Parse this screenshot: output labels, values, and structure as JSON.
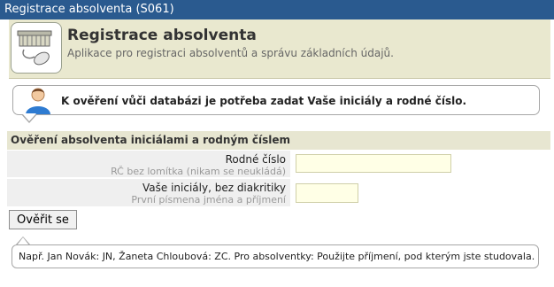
{
  "window": {
    "title": "Registrace absolventa (S061)"
  },
  "app": {
    "icon": "registration-desk-mouse-icon",
    "title": "Registrace absolventa",
    "subtitle": "Aplikace pro registraci absolventů a správu základních údajů."
  },
  "info_message": {
    "icon": "user-avatar-icon",
    "text": "K ověření vůči databázi je potřeba zadat Vaše iniciály a rodné číslo."
  },
  "section": {
    "title": "Ověření absolventa iniciálami a rodným číslem"
  },
  "fields": [
    {
      "label": "Rodné číslo",
      "hint": "RČ bez lomítka (nikam se neukládá)",
      "value": ""
    },
    {
      "label": "Vaše iniciály, bez diakritiky",
      "hint": "První písmena jména a příjmení",
      "value": ""
    }
  ],
  "submit": {
    "label": "Ověřit se"
  },
  "help": {
    "text": "Např. Jan Novák: JN, Žaneta Chloubová: ZC. Pro absolventky: Použijte příjmení, pod kterým jste studovala."
  },
  "colors": {
    "titlebar": "#2a5a8f",
    "header_bg": "#e9e8cf",
    "input_bg": "#ffffe6"
  }
}
